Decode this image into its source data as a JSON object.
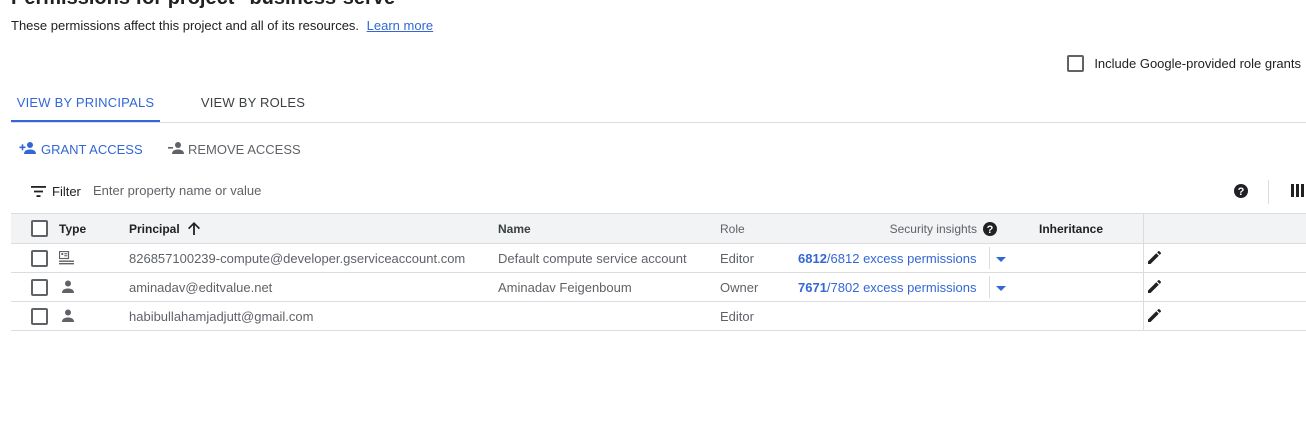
{
  "header": {
    "title": "Permissions for project \"business-serve\"",
    "subtitle": "These permissions affect this project and all of its resources.",
    "learn_more": "Learn more"
  },
  "options": {
    "google_roles_label": "Include Google-provided role grants",
    "google_roles_checked": false
  },
  "tabs": [
    {
      "label": "VIEW BY PRINCIPALS",
      "active": true
    },
    {
      "label": "VIEW BY ROLES",
      "active": false
    }
  ],
  "actions": {
    "grant_label": "GRANT ACCESS",
    "remove_label": "REMOVE ACCESS"
  },
  "filter": {
    "label": "Filter",
    "placeholder": "Enter property name or value"
  },
  "table": {
    "columns": {
      "type": "Type",
      "principal": "Principal",
      "name": "Name",
      "role": "Role",
      "security_insights": "Security insights",
      "inheritance": "Inheritance"
    },
    "sort": {
      "column": "Principal",
      "direction": "ascending"
    },
    "rows": [
      {
        "type_icon": "service-account-icon",
        "principal": "826857100239-compute@developer.gserviceaccount.com",
        "name": "Default compute service account",
        "role": "Editor",
        "excess": "6812",
        "insight": "/6812 excess permissions",
        "inheritance": ""
      },
      {
        "type_icon": "person-icon",
        "principal": "aminadav@editvalue.net",
        "name": "Aminadav Feigenboum",
        "role": "Owner",
        "excess": "7671",
        "insight": "/7802 excess permissions",
        "inheritance": ""
      },
      {
        "type_icon": "person-icon",
        "principal": "habibullahamjadjutt@gmail.com",
        "name": "",
        "role": "Editor",
        "excess": "",
        "insight": "",
        "inheritance": ""
      }
    ]
  },
  "colors": {
    "accent": "#3367d6",
    "text": "#202124",
    "muted": "#5f6368",
    "header_bg": "#f1f3f4",
    "divider": "#dadce0"
  }
}
